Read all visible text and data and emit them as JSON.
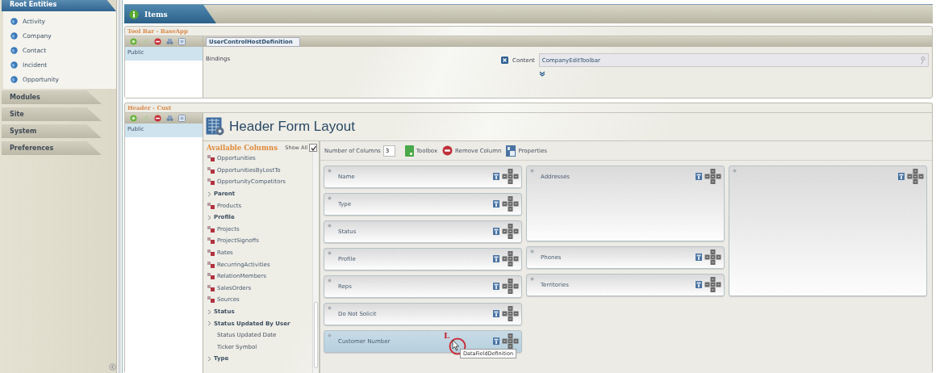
{
  "sidebar": {
    "sections": [
      {
        "label": "Root Entities",
        "expanded": true,
        "items": [
          {
            "label": "Activity"
          },
          {
            "label": "Company"
          },
          {
            "label": "Contact"
          },
          {
            "label": "Incident"
          },
          {
            "label": "Opportunity"
          }
        ]
      },
      {
        "label": "Modules",
        "expanded": false
      },
      {
        "label": "Site",
        "expanded": false
      },
      {
        "label": "System",
        "expanded": false
      },
      {
        "label": "Preferences",
        "expanded": false
      }
    ]
  },
  "items_tab": {
    "label": "Items",
    "selected": true
  },
  "toolbar_panel": {
    "title": "Tool Bar - BaseApp",
    "roles": [
      {
        "label": "Public",
        "selected": true
      }
    ],
    "breadcrumb": "UserControlHostDefinition",
    "bindings_label": "Bindings",
    "content_label": "Content",
    "content_value": "CompanyEditToolbar"
  },
  "header_panel": {
    "title": "Header - Cust",
    "roles": [
      {
        "label": "Public",
        "selected": true
      }
    ],
    "heading": "Header Form Layout",
    "available_columns": {
      "title": "Available Columns",
      "show_all": {
        "label": "Show All",
        "checked": true
      },
      "items": [
        {
          "label": "Opportunities",
          "kind": "relation"
        },
        {
          "label": "OpportunitiesByLostTo",
          "kind": "relation"
        },
        {
          "label": "OpportunityCompetitors",
          "kind": "relation"
        },
        {
          "label": "Parent",
          "kind": "group"
        },
        {
          "label": "Products",
          "kind": "relation"
        },
        {
          "label": "Profile",
          "kind": "group"
        },
        {
          "label": "Projects",
          "kind": "relation"
        },
        {
          "label": "ProjectSignoffs",
          "kind": "relation"
        },
        {
          "label": "Rates",
          "kind": "relation"
        },
        {
          "label": "RecurringActivities",
          "kind": "relation"
        },
        {
          "label": "RelationMembers",
          "kind": "relation"
        },
        {
          "label": "SalesOrders",
          "kind": "relation"
        },
        {
          "label": "Sources",
          "kind": "relation"
        },
        {
          "label": "Status",
          "kind": "group"
        },
        {
          "label": "Status Updated By User",
          "kind": "group"
        },
        {
          "label": "Status Updated Date",
          "kind": "field"
        },
        {
          "label": "Ticker Symbol",
          "kind": "field"
        },
        {
          "label": "Type",
          "kind": "group"
        }
      ]
    },
    "designer": {
      "columns_label": "Number of Columns",
      "columns_value": "3",
      "actions": [
        {
          "label": "Toolbox",
          "kind": "toolbox"
        },
        {
          "label": "Remove Column",
          "kind": "remove"
        },
        {
          "label": "Properties",
          "kind": "properties"
        }
      ],
      "columns": [
        {
          "cards": [
            {
              "label": "Name",
              "kind": "field",
              "selected": false
            },
            {
              "label": "Type",
              "kind": "field",
              "selected": false
            },
            {
              "label": "Status",
              "kind": "field",
              "selected": false
            },
            {
              "label": "Profile",
              "kind": "field",
              "selected": false
            },
            {
              "label": "Reps",
              "kind": "field",
              "selected": false
            },
            {
              "label": "Do Not Solicit",
              "kind": "field",
              "selected": false
            },
            {
              "label": "Customer Number",
              "kind": "field",
              "selected": true
            }
          ]
        },
        {
          "cards": [
            {
              "label": "Addresses",
              "kind": "group",
              "selected": false
            },
            {
              "label": "Phones",
              "kind": "field",
              "selected": false
            },
            {
              "label": "Territories",
              "kind": "field",
              "selected": false
            }
          ]
        },
        {
          "cards": [
            {
              "kind": "group",
              "selected": false
            }
          ]
        }
      ],
      "click_marker": "L",
      "tooltip": "DataFieldDefinition"
    }
  }
}
